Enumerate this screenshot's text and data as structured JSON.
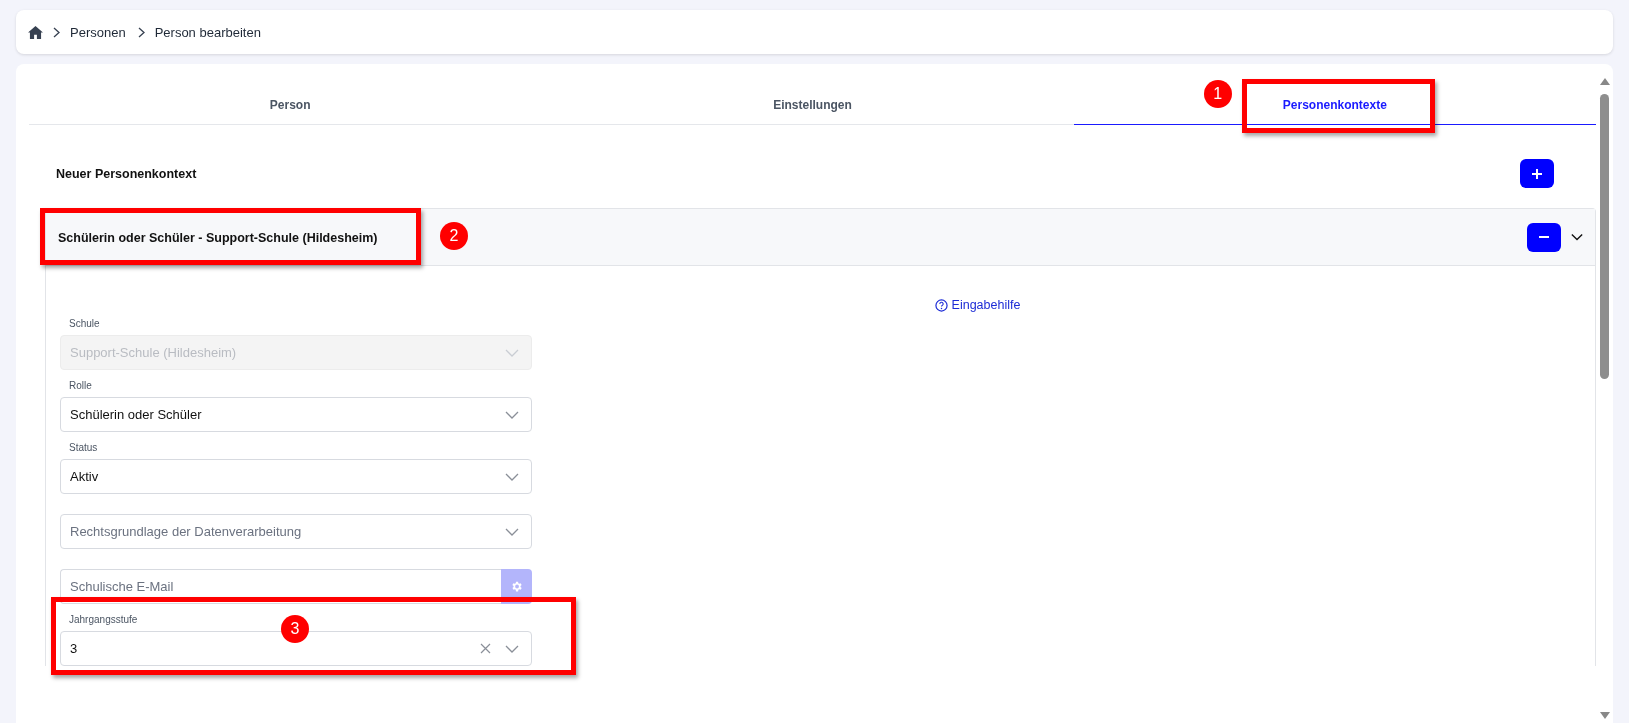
{
  "breadcrumb": [
    "Personen",
    "Person bearbeiten"
  ],
  "tabs": [
    {
      "label": "Person",
      "selected": false
    },
    {
      "label": "Einstellungen",
      "selected": false
    },
    {
      "label": "Personenkontexte",
      "selected": true,
      "callout": "1"
    }
  ],
  "new_context": {
    "label": "Neuer Personenkontext"
  },
  "panel": {
    "title": "Schülerin oder Schüler - Support-Schule (Hildesheim)",
    "expanded": true,
    "callout": "2",
    "help_link": "Eingabehilfe",
    "fields": [
      {
        "kind": "select",
        "label": "Schule",
        "value": "Support-Schule (Hildesheim)",
        "disabled": true
      },
      {
        "kind": "select",
        "label": "Rolle",
        "value": "Schülerin oder Schüler",
        "disabled": false
      },
      {
        "kind": "select",
        "label": "Status",
        "value": "Aktiv",
        "disabled": false
      },
      {
        "kind": "select",
        "placeholder": "Rechtsgrundlage der Datenverarbeitung",
        "disabled": false
      },
      {
        "kind": "text",
        "placeholder": "Schulische E-Mail",
        "disabled": false
      },
      {
        "kind": "select",
        "label": "Jahrgangsstufe",
        "value": "3",
        "disabled": false,
        "clearable": true,
        "callout": "3"
      }
    ]
  }
}
